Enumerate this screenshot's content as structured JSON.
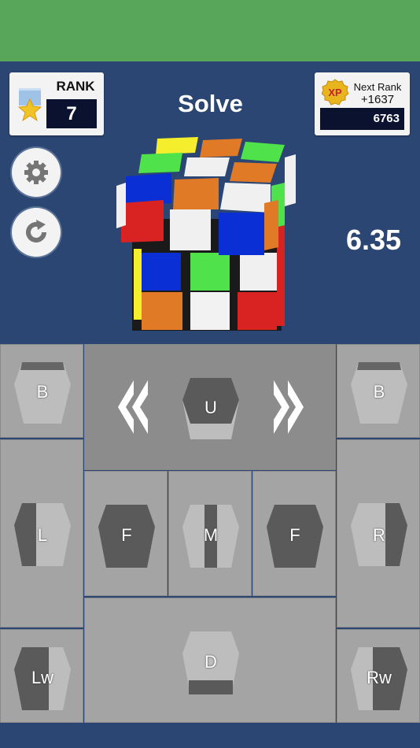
{
  "header": {
    "rank_label": "RANK",
    "rank_value": "7",
    "mode_title": "Solve",
    "xp_badge": "XP",
    "next_rank_label": "Next Rank",
    "next_rank_gain": "+1637",
    "xp_total": "6763",
    "timer": "6.35"
  },
  "icons": {
    "medal": "medal-icon",
    "settings": "gear-icon",
    "reset": "refresh-icon",
    "rotate_left": "double-chevron-left-icon",
    "rotate_right": "double-chevron-right-icon"
  },
  "moves": {
    "back_left": "B",
    "up": "U",
    "back_right": "B",
    "left": "L",
    "front_left": "F",
    "middle": "M",
    "front_right": "F",
    "right": "R",
    "wide_left": "Lw",
    "down": "D",
    "wide_right": "Rw"
  },
  "colors": {
    "topbar": "#58a65a",
    "background": "#2b4672",
    "panel": "#a4a4a4"
  }
}
